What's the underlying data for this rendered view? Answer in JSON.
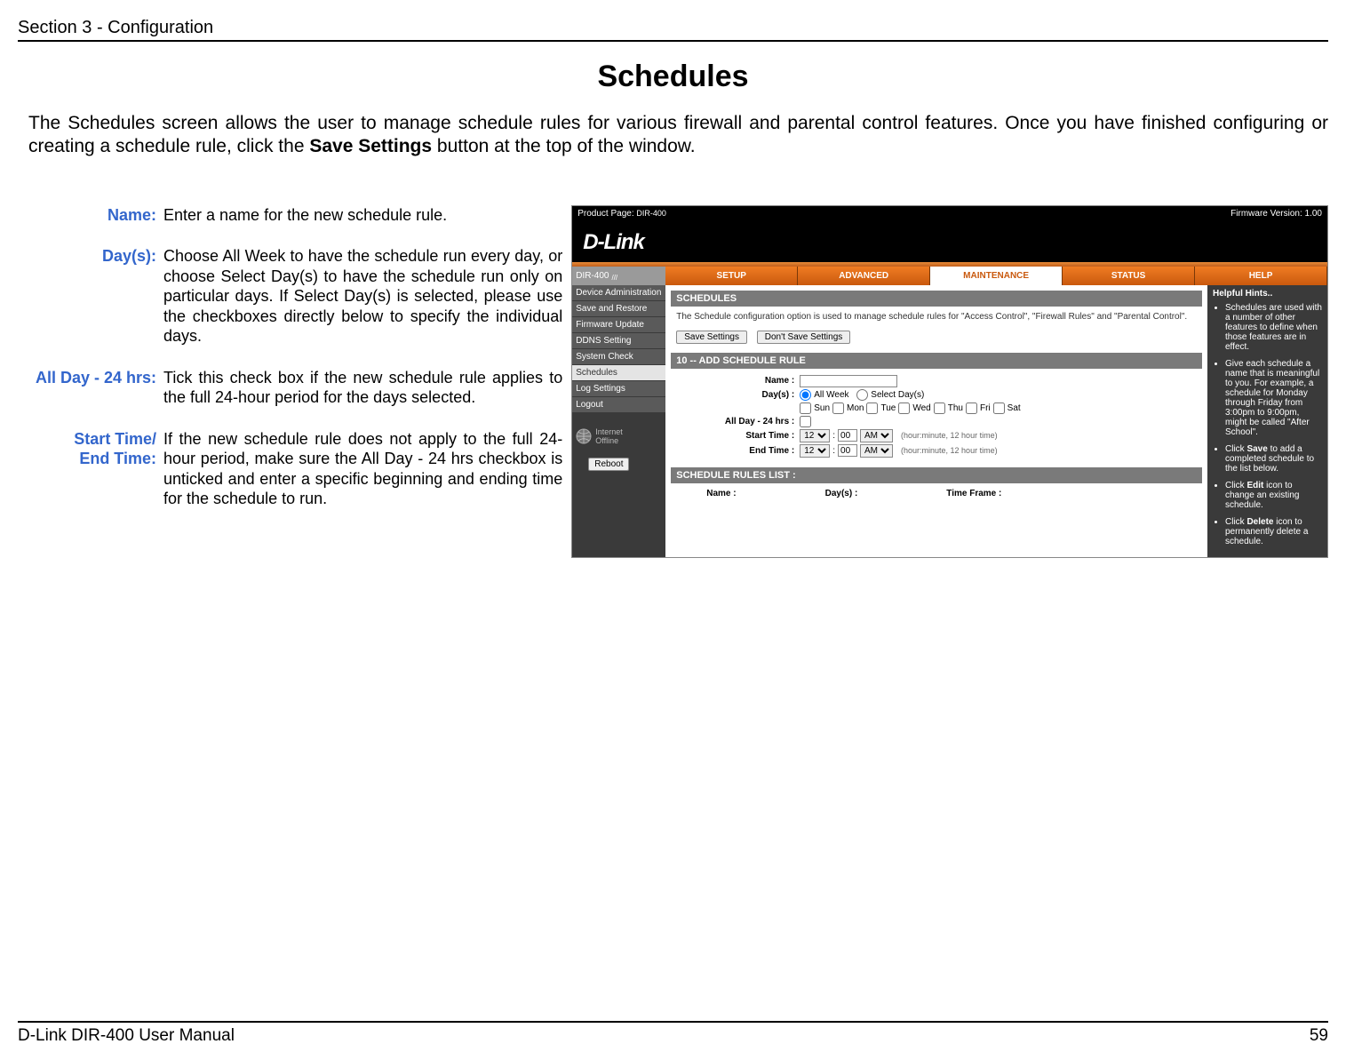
{
  "header": {
    "section": "Section 3 - Configuration"
  },
  "title": "Schedules",
  "intro": {
    "part1": "The Schedules screen allows the user to manage schedule rules for various firewall and parental control features. Once you have finished configuring or creating a schedule rule, click the ",
    "bold": "Save Settings",
    "part2": " button at the top of the window."
  },
  "defs": {
    "name": {
      "label": "Name:",
      "text": "Enter a name for the new schedule rule."
    },
    "days": {
      "label": "Day(s):",
      "text": "Choose All Week to have the schedule run every day, or choose Select Day(s) to have the schedule run only on particular days. If Select Day(s) is selected, please use the checkboxes directly below to specify the individual days."
    },
    "allday": {
      "label": "All Day - 24 hrs:",
      "text": "Tick this check box if the new schedule rule applies to the full 24-hour period for the days selected."
    },
    "time": {
      "label1": "Start Time/",
      "label2": "End Time:",
      "text": "If the new schedule rule does not apply to the full 24-hour period, make sure the All Day - 24 hrs checkbox is unticked and enter a specific beginning and ending time for the schedule to run."
    }
  },
  "router": {
    "topbar": {
      "left_label": "Product Page:",
      "left_value": "DIR-400",
      "right_label": "Firmware Version:",
      "right_value": "1.00"
    },
    "logo": "D-Link",
    "model": "DIR-400",
    "tabs": [
      "SETUP",
      "ADVANCED",
      "MAINTENANCE",
      "STATUS",
      "HELP"
    ],
    "active_tab_index": 2,
    "sidebar": [
      "Device Administration",
      "Save and Restore",
      "Firmware Update",
      "DDNS Setting",
      "System Check",
      "Schedules",
      "Log Settings",
      "Logout"
    ],
    "sidebar_active_index": 5,
    "internet": {
      "label": "Internet",
      "state": "Offline"
    },
    "reboot_btn": "Reboot",
    "main": {
      "heading1": "SCHEDULES",
      "desc": "The Schedule configuration option is used to manage schedule rules for \"Access Control\", \"Firewall Rules\" and \"Parental Control\".",
      "save_btn": "Save Settings",
      "nosave_btn": "Don't Save Settings",
      "heading2": "10 -- ADD SCHEDULE RULE",
      "form": {
        "name_label": "Name :",
        "days_label": "Day(s) :",
        "days_allweek": "All Week",
        "days_select": "Select Day(s)",
        "day_names": [
          "Sun",
          "Mon",
          "Tue",
          "Wed",
          "Thu",
          "Fri",
          "Sat"
        ],
        "allday_label": "All Day - 24 hrs :",
        "start_label": "Start Time :",
        "end_label": "End Time :",
        "hour": "12",
        "minute": "00",
        "ampm": "AM",
        "timehint": "(hour:minute, 12 hour time)"
      },
      "heading3": "SCHEDULE RULES LIST :",
      "th_name": "Name :",
      "th_days": "Day(s) :",
      "th_time": "Time Frame :"
    },
    "help": {
      "title": "Helpful Hints..",
      "t1a": "Schedules are used with a number of other features to define when those features are in effect.",
      "t2a": "Give each schedule a name that is meaningful to you. For example, a schedule for Monday through Friday from 3:00pm to 9:00pm, might be called \"After School\".",
      "t3a": "Click ",
      "t3b": "Save",
      "t3c": " to add a completed schedule to the list below.",
      "t4a": "Click ",
      "t4b": "Edit",
      "t4c": " icon to change an existing schedule.",
      "t5a": "Click ",
      "t5b": "Delete",
      "t5c": " icon to permanently delete a schedule."
    }
  },
  "footer": {
    "left": "D-Link DIR-400 User Manual",
    "right": "59"
  }
}
